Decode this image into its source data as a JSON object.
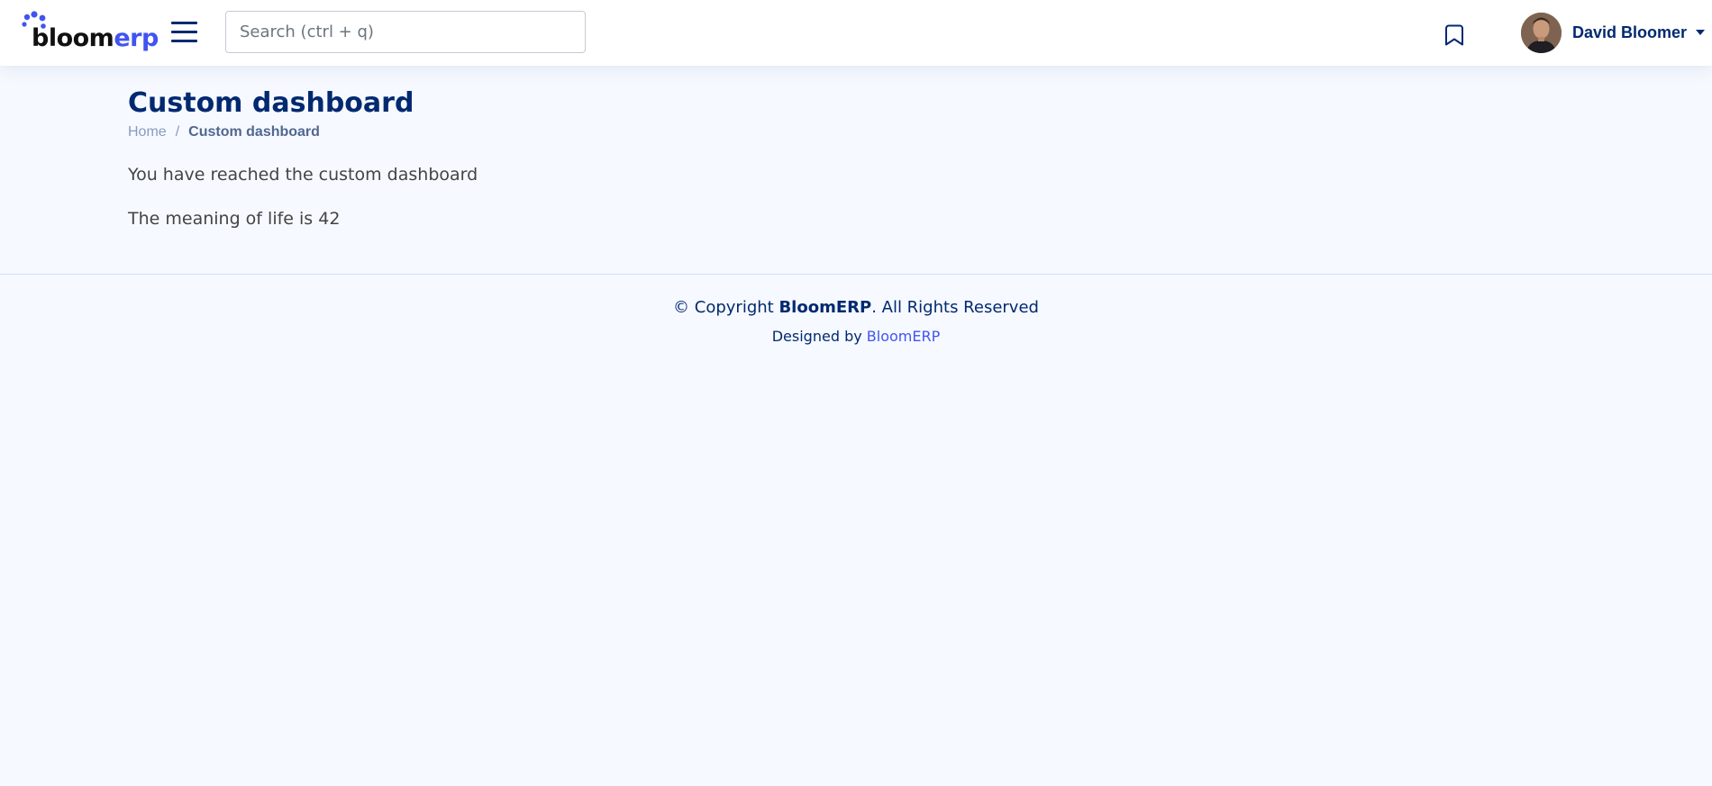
{
  "header": {
    "logo": {
      "part1": "bloom",
      "part2": "erp"
    },
    "search": {
      "placeholder": "Search (ctrl + q)",
      "value": ""
    },
    "user": {
      "name": "David Bloomer"
    }
  },
  "page": {
    "title": "Custom dashboard",
    "breadcrumb": {
      "home": "Home",
      "separator": "/",
      "current": "Custom dashboard"
    },
    "paragraphs": [
      "You have reached the custom dashboard",
      "The meaning of life is 42"
    ]
  },
  "footer": {
    "copyright_prefix": "© Copyright ",
    "copyright_brand": "BloomERP",
    "copyright_suffix": ". All Rights Reserved",
    "designed_by": "Designed by ",
    "designed_link": "BloomERP"
  },
  "colors": {
    "primary": "#012970",
    "accent": "#4154f1",
    "background": "#f6f9ff",
    "muted": "#899bbd"
  },
  "icons": [
    "menu-icon",
    "bookmark-icon",
    "caret-down-icon"
  ]
}
